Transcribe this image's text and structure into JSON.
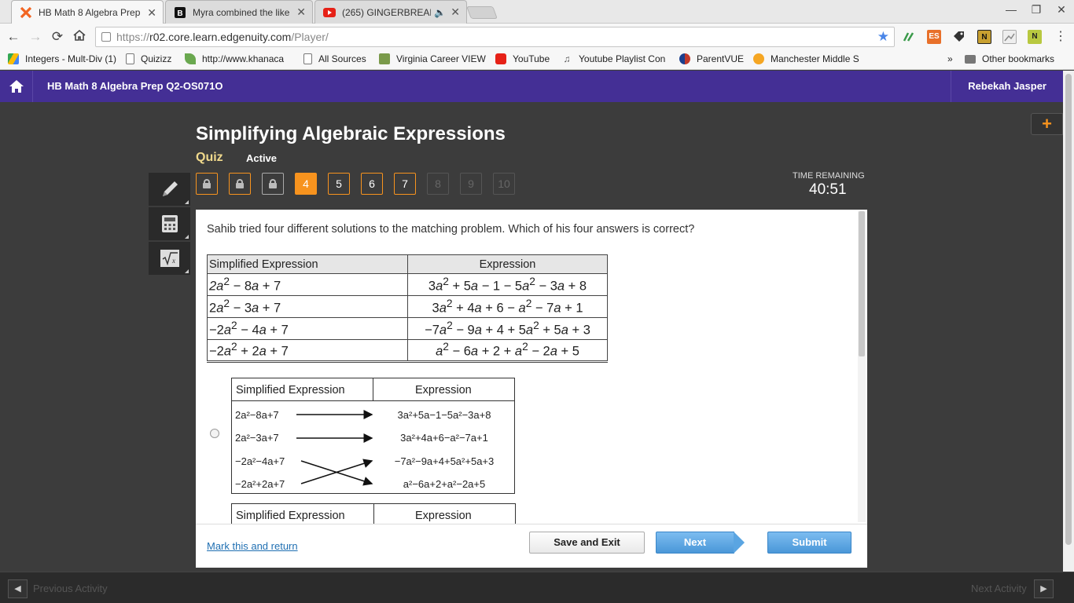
{
  "browser": {
    "tabs": [
      {
        "title": "HB Math 8 Algebra Prep",
        "active": true
      },
      {
        "title": "Myra combined the like t",
        "active": false
      },
      {
        "title": "(265) GINGERBREAD",
        "active": false
      }
    ],
    "url_scheme": "https://",
    "url_host": "r02.core.learn.edgenuity.com",
    "url_path": "/Player/",
    "extensions": [
      "ES",
      "N",
      "N"
    ]
  },
  "bookmarks": [
    {
      "label": "Integers - Mult-Div (1)"
    },
    {
      "label": "Quizizz"
    },
    {
      "label": "http://www.khanaca"
    },
    {
      "label": "All Sources"
    },
    {
      "label": "Virginia Career VIEW"
    },
    {
      "label": "YouTube"
    },
    {
      "label": "Youtube Playlist Con"
    },
    {
      "label": "ParentVUE"
    },
    {
      "label": "Manchester Middle S"
    },
    {
      "label": "Other bookmarks"
    }
  ],
  "header": {
    "course": "HB Math 8 Algebra Prep Q2-OS071O",
    "user": "Rebekah Jasper"
  },
  "page": {
    "title": "Simplifying Algebraic Expressions",
    "quiz_label": "Quiz",
    "status": "Active",
    "timer_label": "TIME REMAINING",
    "timer_value": "40:51"
  },
  "question_nav": [
    {
      "label": "",
      "state": "locked"
    },
    {
      "label": "",
      "state": "locked"
    },
    {
      "label": "",
      "state": "locked-gray"
    },
    {
      "label": "4",
      "state": "current"
    },
    {
      "label": "5",
      "state": "open"
    },
    {
      "label": "6",
      "state": "open"
    },
    {
      "label": "7",
      "state": "open"
    },
    {
      "label": "8",
      "state": "disabled"
    },
    {
      "label": "9",
      "state": "disabled"
    },
    {
      "label": "10",
      "state": "disabled"
    }
  ],
  "question": {
    "text": "Sahib tried four different solutions to the matching problem. Which of his four answers is correct?",
    "table_headers": [
      "Simplified Expression",
      "Expression"
    ]
  },
  "option1": {
    "headers": [
      "Simplified Expression",
      "Expression"
    ],
    "left": [
      "2a²−8a+7",
      "2a²−3a+7",
      "−2a²−4a+7",
      "−2a²+2a+7"
    ],
    "right": [
      "3a²+5a−1−5a²−3a+8",
      "3a²+4a+6−a²−7a+1",
      "−7a²−9a+4+5a²+5a+3",
      "a²−6a+2+a²−2a+5"
    ],
    "mapping": [
      0,
      1,
      3,
      2
    ]
  },
  "option2": {
    "headers": [
      "Simplified Expression",
      "Expression"
    ]
  },
  "actions": {
    "mark_return": "Mark this and return",
    "save_exit": "Save and Exit",
    "next": "Next",
    "submit": "Submit"
  },
  "footer": {
    "previous": "Previous Activity",
    "next": "Next Activity"
  }
}
